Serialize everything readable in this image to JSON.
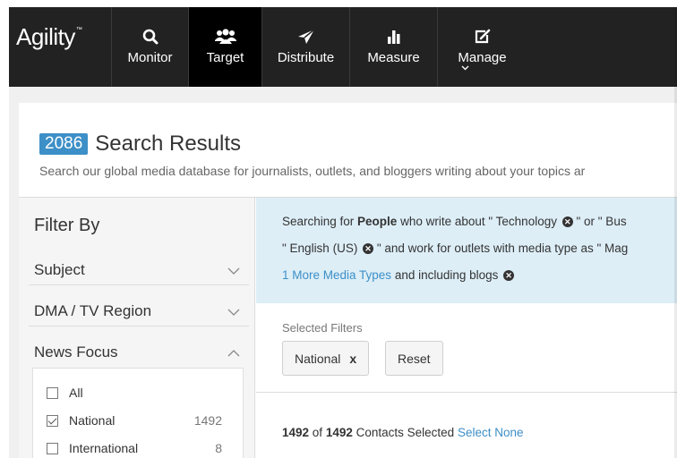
{
  "app": {
    "logo": "Agility",
    "logo_tm": "™"
  },
  "nav": {
    "items": [
      {
        "label": "Monitor",
        "icon": "search-icon"
      },
      {
        "label": "Target",
        "icon": "people-icon",
        "active": true
      },
      {
        "label": "Distribute",
        "icon": "send-icon"
      },
      {
        "label": "Measure",
        "icon": "bar-chart-icon"
      },
      {
        "label": "Manage",
        "icon": "edit-icon"
      }
    ]
  },
  "results": {
    "count": "2086",
    "title": "Search Results",
    "subtitle": "Search our global media database for journalists, outlets, and bloggers writing about your topics ar"
  },
  "filters": {
    "title": "Filter By",
    "facets": [
      "Subject",
      "DMA / TV Region",
      "News Focus"
    ],
    "news_focus_options": [
      {
        "label": "All",
        "count": "",
        "checked": false
      },
      {
        "label": "National",
        "count": "1492",
        "checked": true
      },
      {
        "label": "International",
        "count": "8",
        "checked": false
      }
    ]
  },
  "search_summary": {
    "line1_a": "Searching for ",
    "line1_people": "People",
    "line1_b": " who write about \" Technology ",
    "line1_c": " \" or \" Bus",
    "line2_a": "\" English (US) ",
    "line2_b": " \"  and work for outlets with media type as \" Mag",
    "line3_link": "1 More Media Types",
    "line3_b": "  and including blogs "
  },
  "selected_filters": {
    "label": "Selected Filters",
    "chip_label": "National",
    "chip_remove": "x",
    "reset_label": "Reset"
  },
  "selection": {
    "selected": "1492",
    "of_text": " of ",
    "total": "1492",
    "contacts_text": " Contacts Selected ",
    "select_none": "Select None"
  },
  "colors": {
    "accent": "#3d8fc7",
    "nav_bg": "#222222",
    "nav_active": "#000000",
    "summary_bg": "#ddeef7"
  }
}
